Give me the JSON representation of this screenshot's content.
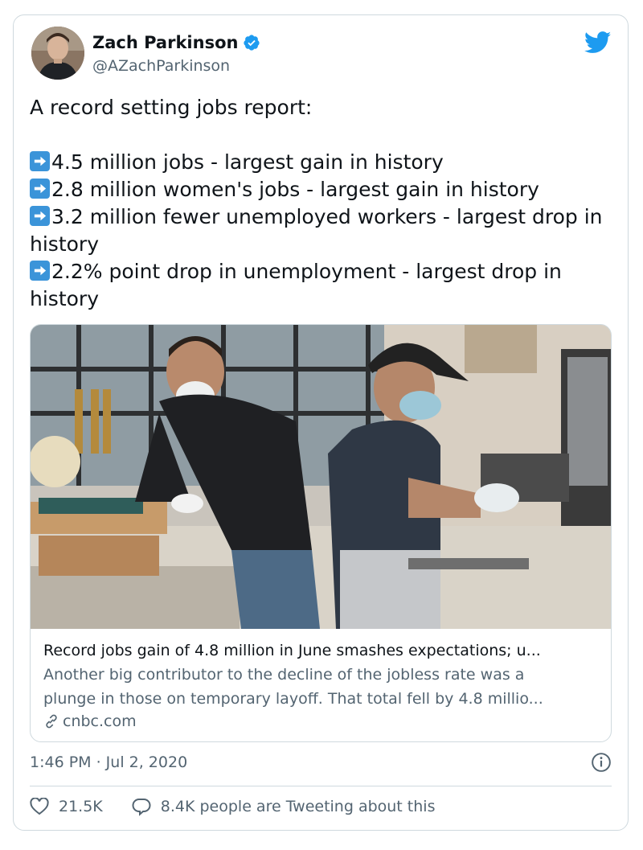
{
  "author": {
    "name": "Zach Parkinson",
    "handle": "@AZachParkinson",
    "verified": true
  },
  "tweet": {
    "intro": "A record setting jobs report:",
    "bullets": [
      "4.5 million jobs - largest gain in history",
      "2.8 million women's jobs - largest gain in history",
      "3.2 million fewer unemployed workers - largest drop in history",
      "2.2% point drop in unemployment - largest drop in history"
    ],
    "bullet_emoji": "right-arrow-emoji"
  },
  "link_card": {
    "title": "Record jobs gain of 4.8 million in June smashes expectations; u...",
    "description_line1": "Another big contributor to the decline of the jobless rate was a",
    "description_line2": "plunge in those on temporary layoff. That total fell by 4.8 millio...",
    "domain": "cnbc.com",
    "image_icon": "photo-of-restaurant-workers-in-masks"
  },
  "meta": {
    "timestamp": "1:46 PM · Jul 2, 2020"
  },
  "actions": {
    "likes": "21.5K",
    "tweeting": "8.4K people are Tweeting about this"
  },
  "colors": {
    "twitter_blue": "#1d9bf0",
    "text_primary": "#0f1419",
    "text_secondary": "#536471",
    "border": "#cfd9de"
  }
}
